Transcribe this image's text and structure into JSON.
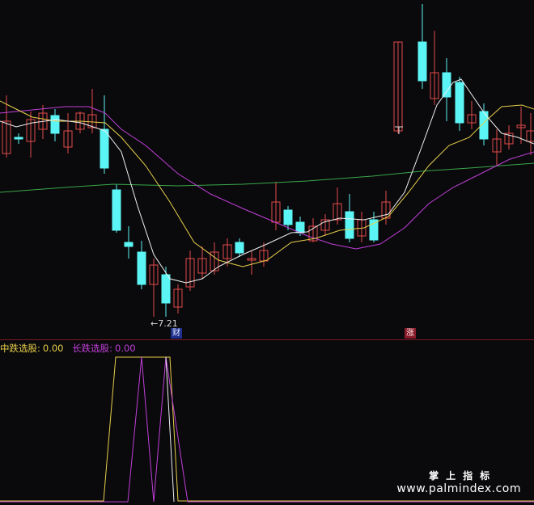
{
  "colors": {
    "background": "#0a090c",
    "up": "#e24a4a",
    "down": "#5cf5f5",
    "ma_white": "#f0f0f0",
    "ma_yellow": "#e8d04a",
    "ma_magenta": "#c040d8",
    "ma_green": "#3aa84a",
    "divider": "#7a1a22",
    "indicator_yellow": "#e8d04a",
    "indicator_magenta": "#c040d8"
  },
  "price_annotation": {
    "label": "←7.21"
  },
  "badges": {
    "cai": "财",
    "zhang": "涨"
  },
  "indicator": {
    "mid_label": "中跌选股:",
    "mid_value": "0.00",
    "long_label": "长跌选股:",
    "long_value": "0.00"
  },
  "watermark": {
    "cn": "掌上指标",
    "url": "www.palmindex.com"
  }
}
